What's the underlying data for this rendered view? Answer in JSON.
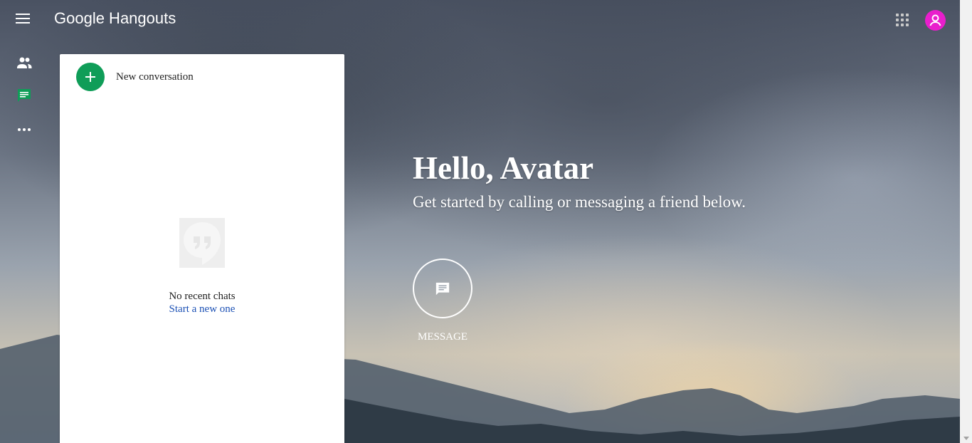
{
  "app": {
    "title": "Google Hangouts"
  },
  "colors": {
    "accent_green": "#0f9d58",
    "account_avatar": "#e91ecc",
    "link_blue": "#1a4fb4"
  },
  "header": {
    "menu_icon": "hamburger-menu-icon",
    "apps_icon": "apps-grid-icon",
    "account_icon": "account-avatar-icon"
  },
  "sidebar": {
    "items": [
      {
        "icon": "contacts-icon"
      },
      {
        "icon": "conversations-icon"
      },
      {
        "icon": "more-icon"
      }
    ]
  },
  "panel": {
    "new_conversation": "New conversation",
    "empty_title": "No recent chats",
    "empty_link": "Start a new one"
  },
  "main": {
    "greeting": "Hello, Avatar",
    "subtitle": "Get started by calling or messaging a friend below.",
    "message_label": "MESSAGE"
  }
}
